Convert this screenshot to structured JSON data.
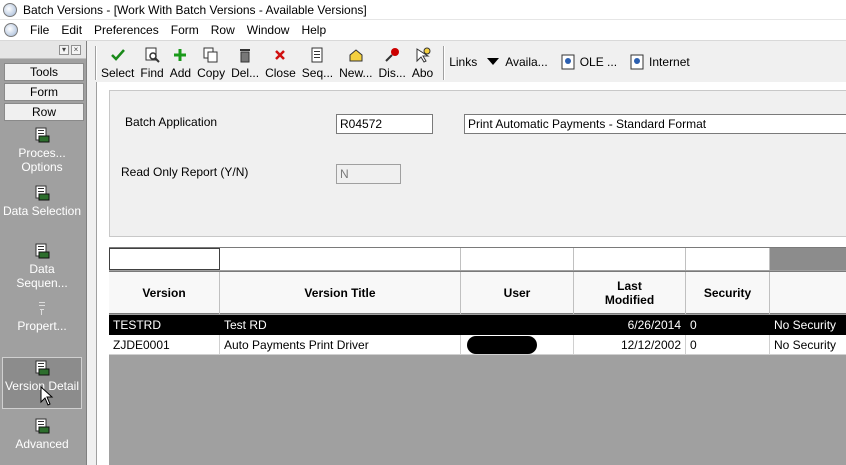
{
  "window": {
    "title": "Batch Versions - [Work With Batch Versions - Available Versions]"
  },
  "menubar": {
    "items": [
      "File",
      "Edit",
      "Preferences",
      "Form",
      "Row",
      "Window",
      "Help"
    ]
  },
  "exit_bars": {
    "tools": "Tools",
    "form": "Form",
    "row": "Row"
  },
  "row_exits": [
    {
      "label": "Proces... Options",
      "icon": "report-icon"
    },
    {
      "label": "Data Selection",
      "icon": "report-icon"
    },
    {
      "label": "Data Sequen...",
      "icon": "report-icon"
    },
    {
      "label": "Propert...",
      "icon": "properties-icon"
    },
    {
      "label": "Version Detail",
      "icon": "report-icon"
    },
    {
      "label": "Advanced",
      "icon": "report-icon"
    }
  ],
  "toolbar": {
    "buttons": [
      {
        "label": "Select",
        "icon": "checkmark-icon",
        "color": "#1a8a1a"
      },
      {
        "label": "Find",
        "icon": "find-icon",
        "color": "#333333"
      },
      {
        "label": "Add",
        "icon": "plus-icon",
        "color": "#1a9a1a"
      },
      {
        "label": "Copy",
        "icon": "copy-icon",
        "color": "#333333"
      },
      {
        "label": "Del...",
        "icon": "trash-icon",
        "color": "#333333"
      },
      {
        "label": "Close",
        "icon": "close-x-icon",
        "color": "#d01010"
      },
      {
        "label": "Seq...",
        "icon": "sequence-icon",
        "color": "#333333"
      },
      {
        "label": "New...",
        "icon": "new-icon",
        "color": "#333333"
      },
      {
        "label": "Dis...",
        "icon": "display-icon",
        "color": "#cc0000"
      },
      {
        "label": "Abo",
        "icon": "about-icon",
        "color": "#333333"
      }
    ],
    "links_label": "Links",
    "availa_label": "Availa...",
    "ole_label": "OLE ...",
    "internet_label": "Internet"
  },
  "header": {
    "batch_application_label": "Batch Application",
    "batch_application_value": "R04572",
    "batch_application_desc": "Print Automatic Payments - Standard Format",
    "read_only_label": "Read Only Report (Y/N)",
    "read_only_value": "N"
  },
  "grid": {
    "columns": [
      "Version",
      "Version Title",
      "User",
      "Last Modified",
      "Security",
      ""
    ],
    "rows": [
      {
        "version": "TESTRD",
        "title": "Test RD",
        "user": "",
        "last_modified": "6/26/2014",
        "security": "0",
        "security_desc": "No Security",
        "selected": true
      },
      {
        "version": "ZJDE0001",
        "title": "Auto Payments Print Driver",
        "user": "",
        "last_modified": "12/12/2002",
        "security": "0",
        "security_desc": "No Security",
        "selected": false
      }
    ]
  }
}
